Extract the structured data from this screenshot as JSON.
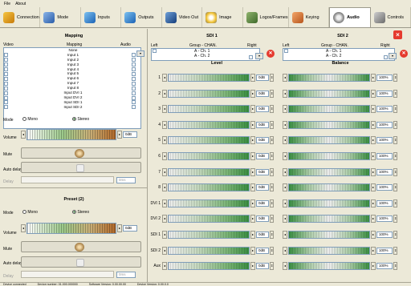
{
  "menu": [
    "File",
    "About"
  ],
  "tabs": [
    {
      "label": "Connection",
      "icon": "plug-icon"
    },
    {
      "label": "Mode",
      "icon": "mode-icon"
    },
    {
      "label": "Inputs",
      "icon": "inputs-icon"
    },
    {
      "label": "Outputs",
      "icon": "outputs-icon"
    },
    {
      "label": "Video Out",
      "icon": "video-out-icon"
    },
    {
      "label": "Image",
      "icon": "image-icon"
    },
    {
      "label": "Logos/Frames",
      "icon": "logos-icon"
    },
    {
      "label": "Keying",
      "icon": "keying-icon"
    },
    {
      "label": "Audio",
      "icon": "speaker-icon",
      "active": true
    },
    {
      "label": "Controls",
      "icon": "controls-icon"
    }
  ],
  "mapping": {
    "title": "Mapping",
    "col_video": "Video",
    "col_mapping": "Mapping",
    "col_audio": "Audio",
    "items": [
      "None",
      "Input 1",
      "Input 2",
      "Input 3",
      "Input 4",
      "Input 5",
      "Input 6",
      "Input 7",
      "Input 8",
      "Input DVI 1",
      "Input DVI 2",
      "Input SDI 1",
      "Input SDI 2"
    ],
    "mode_label": "Mode",
    "mode_mono": "Mono",
    "mode_stereo": "Stereo",
    "volume_label": "Volume",
    "volume_value": "0dB",
    "mute_label": "Mute",
    "auto_delay_label": "Auto delay",
    "delay_label": "Delay",
    "delay_value": "0ms"
  },
  "preset": {
    "title": "Preset (2)",
    "mode_label": "Mode",
    "mode_mono": "Mono",
    "mode_stereo": "Stereo",
    "volume_label": "Volume",
    "volume_value": "0dB",
    "mute_label": "Mute",
    "auto_delay_label": "Auto delay",
    "delay_label": "Delay",
    "delay_value": "0ms"
  },
  "sdi1": {
    "title": "SDI 1",
    "left": "Left",
    "group": "Group - CHAN.",
    "right": "Right",
    "ch1": "A - Ch. 1",
    "ch2": "A - Ch. 2"
  },
  "sdi2": {
    "title": "SDI 2",
    "left": "Left",
    "group": "Group - CHAN.",
    "right": "Right",
    "ch1": "A - Ch. 1",
    "ch2": "A - Ch. 2"
  },
  "level_title": "Level",
  "balance_title": "Balance",
  "channels": [
    {
      "label": "1",
      "level": "0dB",
      "balance": "100%"
    },
    {
      "label": "2",
      "level": "0dB",
      "balance": "100%"
    },
    {
      "label": "3",
      "level": "0dB",
      "balance": "100%"
    },
    {
      "label": "4",
      "level": "0dB",
      "balance": "100%"
    },
    {
      "label": "5",
      "level": "0dB",
      "balance": "100%"
    },
    {
      "label": "6",
      "level": "0dB",
      "balance": "100%"
    },
    {
      "label": "7",
      "level": "0dB",
      "balance": "100%"
    },
    {
      "label": "8",
      "level": "0dB",
      "balance": "100%"
    },
    {
      "label": "DVI 1",
      "level": "0dB",
      "balance": "100%"
    },
    {
      "label": "DVI 2",
      "level": "0dB",
      "balance": "100%"
    },
    {
      "label": "SDI 1",
      "level": "0dB",
      "balance": "100%"
    },
    {
      "label": "SDI 2",
      "level": "0dB",
      "balance": "100%"
    },
    {
      "label": "Aux",
      "level": "0dB",
      "balance": "100%"
    }
  ],
  "status": [
    "Device connected",
    "Device number: 01.000.000000",
    "Software Version: 0.00.00.00",
    "Device Version: 0.00.0.0"
  ],
  "colors": {
    "accent": "#3f9a47",
    "close": "#e53a2e"
  }
}
